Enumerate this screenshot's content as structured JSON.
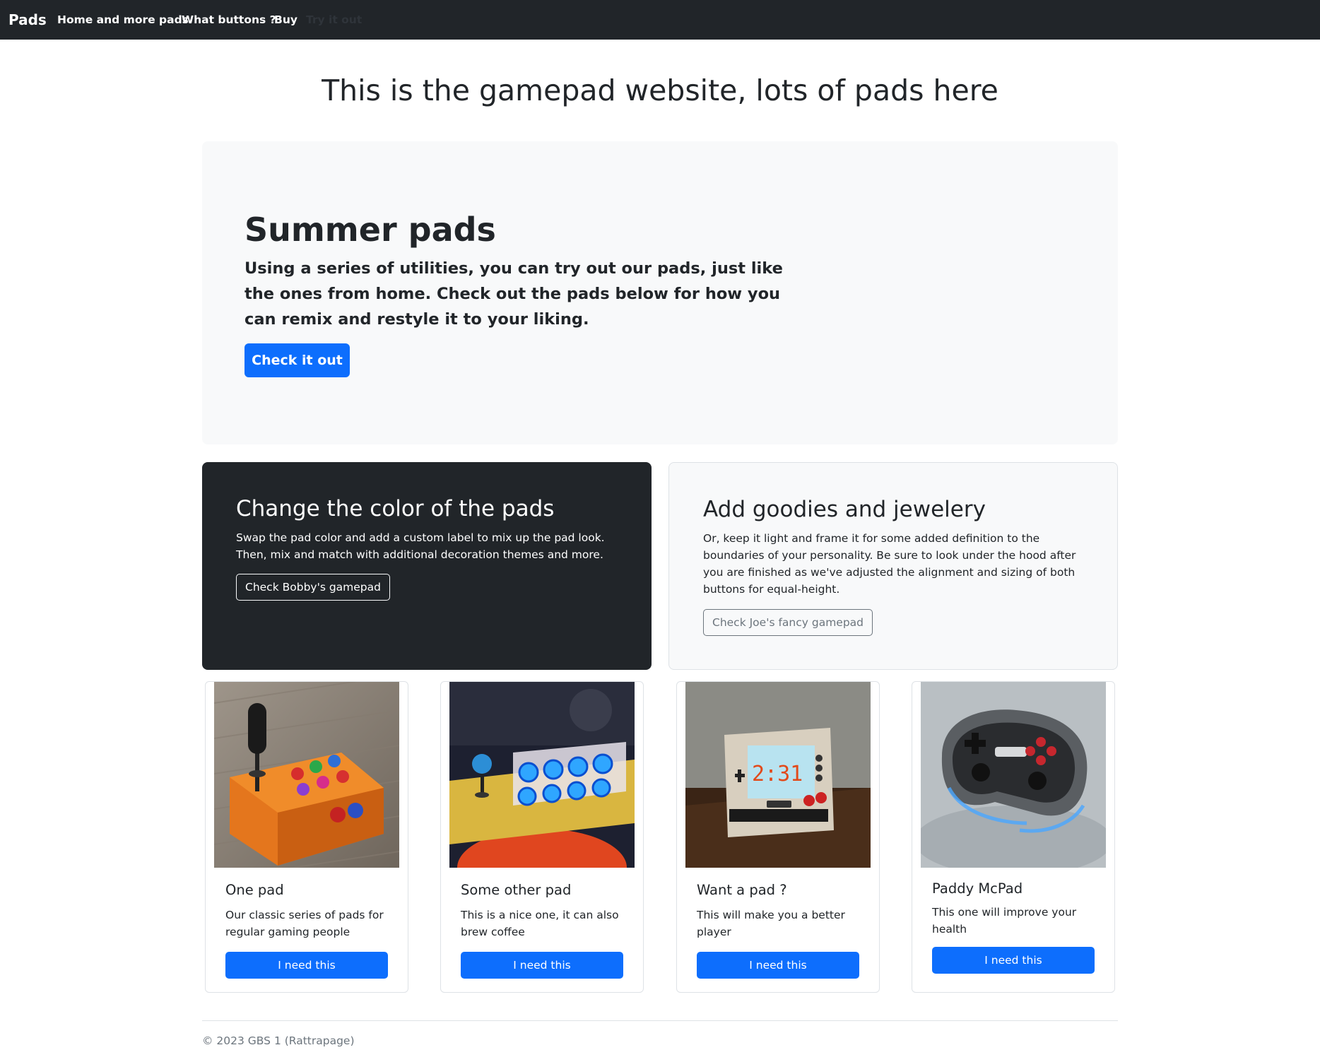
{
  "navbar": {
    "brand": "Pads",
    "links": [
      {
        "label": "Home and more pads",
        "state": "active"
      },
      {
        "label": "What buttons ?",
        "state": "normal"
      },
      {
        "label": "Buy",
        "state": "normal"
      },
      {
        "label": "Try it out",
        "state": "disabled"
      }
    ]
  },
  "page_title": "This is the gamepad website, lots of pads here",
  "hero": {
    "title": "Summer pads",
    "text": "Using a series of utilities, you can try out our pads, just like the ones from home. Check out the pads below for how you can remix and restyle it to your liking.",
    "button": "Check it out"
  },
  "features": [
    {
      "title": "Change the color of the pads",
      "text": "Swap the pad color and add a custom label to mix up the pad look. Then, mix and match with additional decoration themes and more.",
      "button": "Check Bobby's gamepad",
      "theme": "dark"
    },
    {
      "title": "Add goodies and jewelery",
      "text": "Or, keep it light and frame it for some added definition to the boundaries of your personality. Be sure to look under the hood after you are finished as we've adjusted the alignment and sizing of both buttons for equal-height.",
      "button": "Check Joe's fancy gamepad",
      "theme": "light"
    }
  ],
  "cards": [
    {
      "title": "One pad",
      "text": "Our classic series of pads for regular gaming people",
      "button": "I need this",
      "image": "orange arcade joystick box"
    },
    {
      "title": "Some other pad",
      "text": "This is a nice one, it can also brew coffee",
      "button": "I need this",
      "image": "wooden arcade stick with blue lit buttons"
    },
    {
      "title": "Want a pad ?",
      "text": "This will make you a better player",
      "button": "I need this",
      "image": "game and watch handheld console"
    },
    {
      "title": "Paddy McPad",
      "text": "This one will improve your health",
      "button": "I need this",
      "image": "grey wireless gamepad"
    }
  ],
  "footer": {
    "text": "© 2023 GBS 1 (Rattrapage)"
  },
  "colors": {
    "navbar": "#212529",
    "primary": "#0d6efd",
    "light_bg": "#f8f9fa",
    "muted": "#6c757d"
  }
}
